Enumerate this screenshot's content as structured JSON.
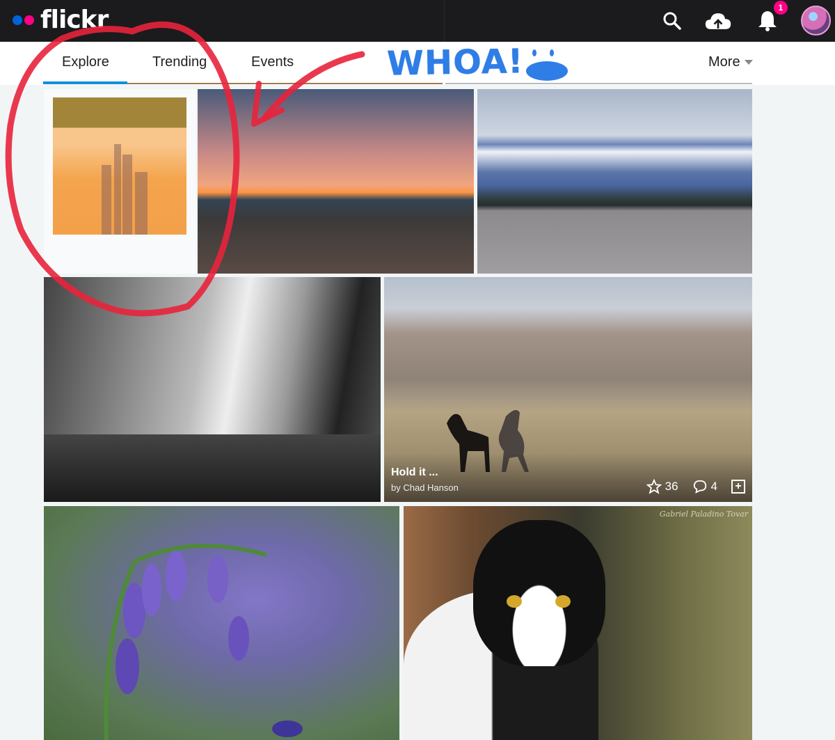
{
  "header": {
    "logo_text": "flickr",
    "logo_dot_colors": [
      "#0063dc",
      "#ff0084"
    ],
    "icons": [
      "search-icon",
      "upload-cloud-icon",
      "notifications-bell-icon"
    ],
    "notification_count": "1"
  },
  "subnav": {
    "tabs": [
      {
        "label": "Explore",
        "active": true
      },
      {
        "label": "Trending",
        "active": false
      },
      {
        "label": "Events",
        "active": false
      }
    ],
    "more_label": "More",
    "accent_color": "#128fdc"
  },
  "photos": [
    {
      "subject": "polaroid city skyline"
    },
    {
      "subject": "sunset over driftwood beach"
    },
    {
      "subject": "snowy mountains over lake"
    },
    {
      "subject": "black and white street with Metropol Parasol"
    },
    {
      "subject": "wild horses before mountain",
      "title": "Hold it ...",
      "author": "by Chad Hanson",
      "faves": "36",
      "comments": "4"
    },
    {
      "subject": "bluebell flowers"
    },
    {
      "subject": "black and white cat in grass",
      "watermark": "Gabriel Paladino Tovar"
    }
  ],
  "annotations": {
    "handwritten_text": "WHOA!",
    "ink_colors": {
      "circle_arrow": "#e8243c",
      "text": "#2f7de6"
    }
  }
}
